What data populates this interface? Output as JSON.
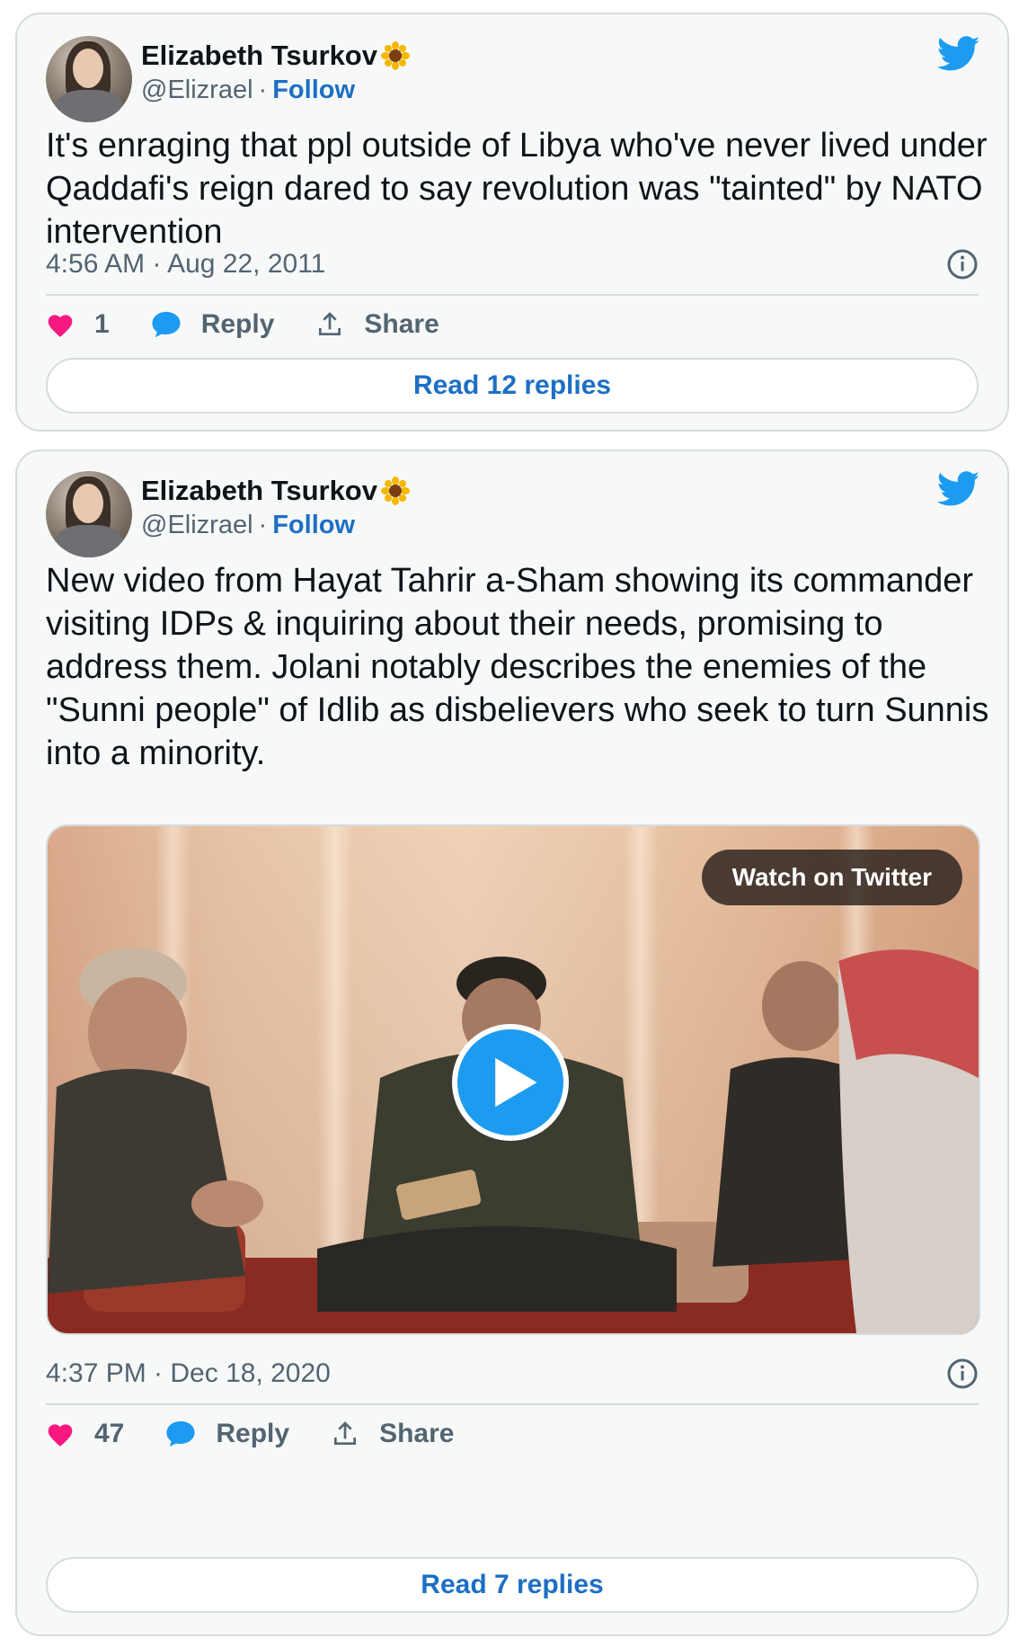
{
  "tweets": [
    {
      "author_name": "Elizabeth Tsurkov",
      "handle": "@Elizrael",
      "separator": "·",
      "follow_label": "Follow",
      "text": "It's enraging that ppl outside of Libya who've never lived under Qaddafi's reign dared to say revolution was \"tainted\" by NATO intervention",
      "timestamp": "4:56 AM · Aug 22, 2011",
      "likes": "1",
      "reply_label": "Reply",
      "share_label": "Share",
      "read_replies_label": "Read 12 replies"
    },
    {
      "author_name": "Elizabeth Tsurkov",
      "handle": "@Elizrael",
      "separator": "·",
      "follow_label": "Follow",
      "text": "New video from Hayat Tahrir a-Sham showing its commander visiting IDPs & inquiring about their needs, promising to address them. Jolani notably describes the enemies of the \"Sunni people\" of Idlib as disbelievers who seek to turn Sunnis into a minority.",
      "timestamp": "4:37 PM · Dec 18, 2020",
      "likes": "47",
      "reply_label": "Reply",
      "share_label": "Share",
      "read_replies_label": "Read 7 replies",
      "video": {
        "watch_label": "Watch on Twitter",
        "play_icon": "play-icon"
      }
    }
  ],
  "colors": {
    "accent": "#1d9bf0",
    "link": "#1d6fc4",
    "like": "#f91880",
    "muted": "#536471",
    "card_bg": "#f7f9f9",
    "border": "#d6dbdf"
  },
  "icons": {
    "twitter": "twitter-bird-icon",
    "info": "info-icon",
    "like": "heart-icon",
    "reply": "speech-bubble-icon",
    "share": "share-upload-icon",
    "emoji": "sunflower-emoji"
  }
}
